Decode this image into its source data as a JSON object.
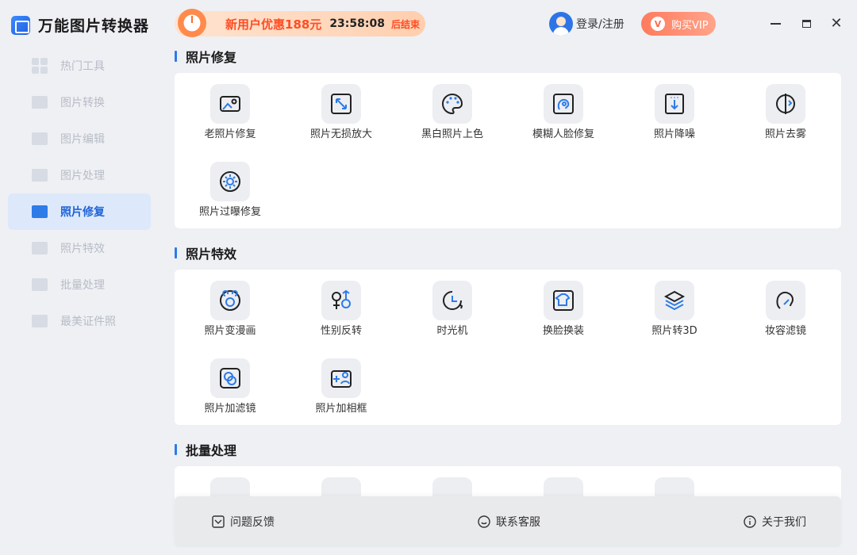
{
  "app": {
    "title": "万能图片转换器"
  },
  "sidebar": {
    "items": [
      {
        "label": "热门工具",
        "name": "sidebar-item-hot-tools"
      },
      {
        "label": "图片转换",
        "name": "sidebar-item-image-convert"
      },
      {
        "label": "图片编辑",
        "name": "sidebar-item-image-edit"
      },
      {
        "label": "图片处理",
        "name": "sidebar-item-image-process"
      },
      {
        "label": "照片修复",
        "name": "sidebar-item-photo-repair",
        "active": true
      },
      {
        "label": "照片特效",
        "name": "sidebar-item-photo-effects"
      },
      {
        "label": "批量处理",
        "name": "sidebar-item-batch"
      },
      {
        "label": "最美证件照",
        "name": "sidebar-item-id-photo"
      }
    ]
  },
  "topbar": {
    "promo_text": "新用户优惠188元",
    "timer": "23:58:08",
    "promo_end": "后结束",
    "login_label": "登录/注册",
    "vip_label": "购买VIP"
  },
  "sections": {
    "repair": {
      "title": "照片修复",
      "tools": [
        {
          "label": "老照片修复",
          "icon": "old-photo-icon"
        },
        {
          "label": "照片无损放大",
          "icon": "enlarge-icon"
        },
        {
          "label": "黑白照片上色",
          "icon": "palette-icon"
        },
        {
          "label": "模糊人脸修复",
          "icon": "face-repair-icon"
        },
        {
          "label": "照片降噪",
          "icon": "denoise-icon"
        },
        {
          "label": "照片去雾",
          "icon": "defog-icon"
        },
        {
          "label": "照片过曝修复",
          "icon": "overexposure-icon"
        }
      ]
    },
    "effects": {
      "title": "照片特效",
      "tools": [
        {
          "label": "照片变漫画",
          "icon": "cartoon-icon"
        },
        {
          "label": "性别反转",
          "icon": "gender-swap-icon"
        },
        {
          "label": "时光机",
          "icon": "time-machine-icon"
        },
        {
          "label": "换脸换装",
          "icon": "outfit-swap-icon"
        },
        {
          "label": "照片转3D",
          "icon": "layers-3d-icon"
        },
        {
          "label": "妆容滤镜",
          "icon": "makeup-icon"
        },
        {
          "label": "照片加滤镜",
          "icon": "filter-icon"
        },
        {
          "label": "照片加相框",
          "icon": "frame-icon"
        }
      ]
    },
    "batch": {
      "title": "批量处理"
    }
  },
  "footer": {
    "feedback": "问题反馈",
    "support": "联系客服",
    "about": "关于我们"
  },
  "colors": {
    "accent": "#2d7be8",
    "promo": "#ff4d24",
    "vip": "#ff7b5d"
  }
}
